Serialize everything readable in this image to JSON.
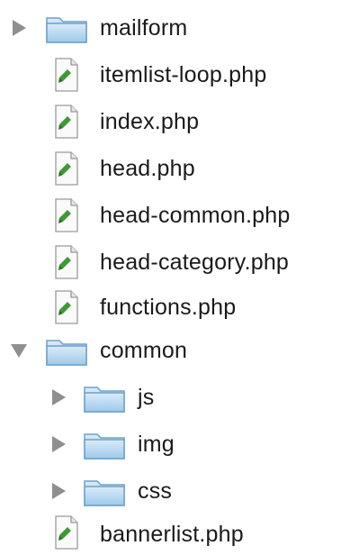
{
  "tree": {
    "items": [
      {
        "label": "mailform",
        "type": "folder",
        "state": "collapsed",
        "depth": 0
      },
      {
        "label": "itemlist-loop.php",
        "type": "file",
        "depth": 1
      },
      {
        "label": "index.php",
        "type": "file",
        "depth": 1
      },
      {
        "label": "head.php",
        "type": "file",
        "depth": 1
      },
      {
        "label": "head-common.php",
        "type": "file",
        "depth": 1
      },
      {
        "label": "head-category.php",
        "type": "file",
        "depth": 1
      },
      {
        "label": "functions.php",
        "type": "file",
        "depth": 1
      },
      {
        "label": "common",
        "type": "folder",
        "state": "expanded",
        "depth": 0
      },
      {
        "label": "js",
        "type": "folder",
        "state": "collapsed",
        "depth": 1
      },
      {
        "label": "img",
        "type": "folder",
        "state": "collapsed",
        "depth": 1
      },
      {
        "label": "css",
        "type": "folder",
        "state": "collapsed",
        "depth": 1
      },
      {
        "label": "bannerlist.php",
        "type": "file",
        "depth": 1
      }
    ]
  },
  "icons": {
    "folder": "folder-icon",
    "file": "php-file-icon",
    "collapsed": "disclosure-triangle-right-icon",
    "expanded": "disclosure-triangle-down-icon"
  },
  "colors": {
    "folder_light": "#cfe6f7",
    "folder_dark": "#6fa8d6",
    "triangle": "#8f8f8f",
    "file_badge": "#3f9a35"
  }
}
